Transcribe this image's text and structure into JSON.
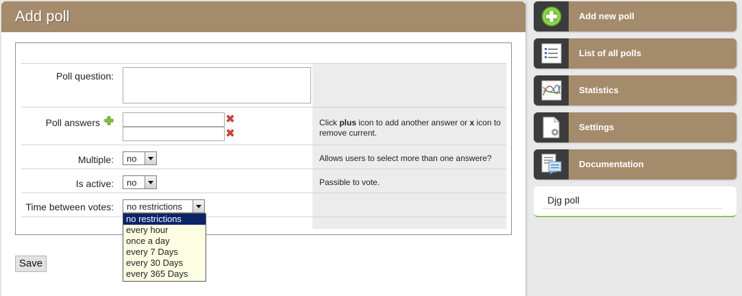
{
  "page": {
    "title": "Add poll"
  },
  "form": {
    "question_label": "Poll question:",
    "answers_label": "Poll answers",
    "answers_help_pre": "Click ",
    "answers_help_bold1": "plus",
    "answers_help_mid": " icon to add another answer or ",
    "answers_help_bold2": "x",
    "answers_help_post": " icon to remove current.",
    "multiple_label": "Multiple:",
    "multiple_value": "no",
    "multiple_help": "Allows users to select more than one answere?",
    "active_label": "Is active:",
    "active_value": "no",
    "active_help": "Passible to vote.",
    "time_label": "Time between votes:",
    "time_value": "no restrictions",
    "time_options": [
      "no restrictions",
      "every hour",
      "once a day",
      "every 7 Days",
      "every 30 Days",
      "every 365 Days"
    ],
    "save_label": "Save"
  },
  "sidebar": {
    "items": [
      {
        "label": "Add new poll",
        "icon": "add-circle-icon"
      },
      {
        "label": "List of all polls",
        "icon": "list-icon"
      },
      {
        "label": "Statistics",
        "icon": "chart-icon"
      },
      {
        "label": "Settings",
        "icon": "settings-document-icon"
      },
      {
        "label": "Documentation",
        "icon": "documentation-icon"
      }
    ],
    "widget_text": "Djg poll"
  },
  "colors": {
    "accent": "#a48b6c",
    "icon_box": "#3c3c3c",
    "help_bg": "#ececec",
    "dropdown_selected": "#0a246a"
  }
}
